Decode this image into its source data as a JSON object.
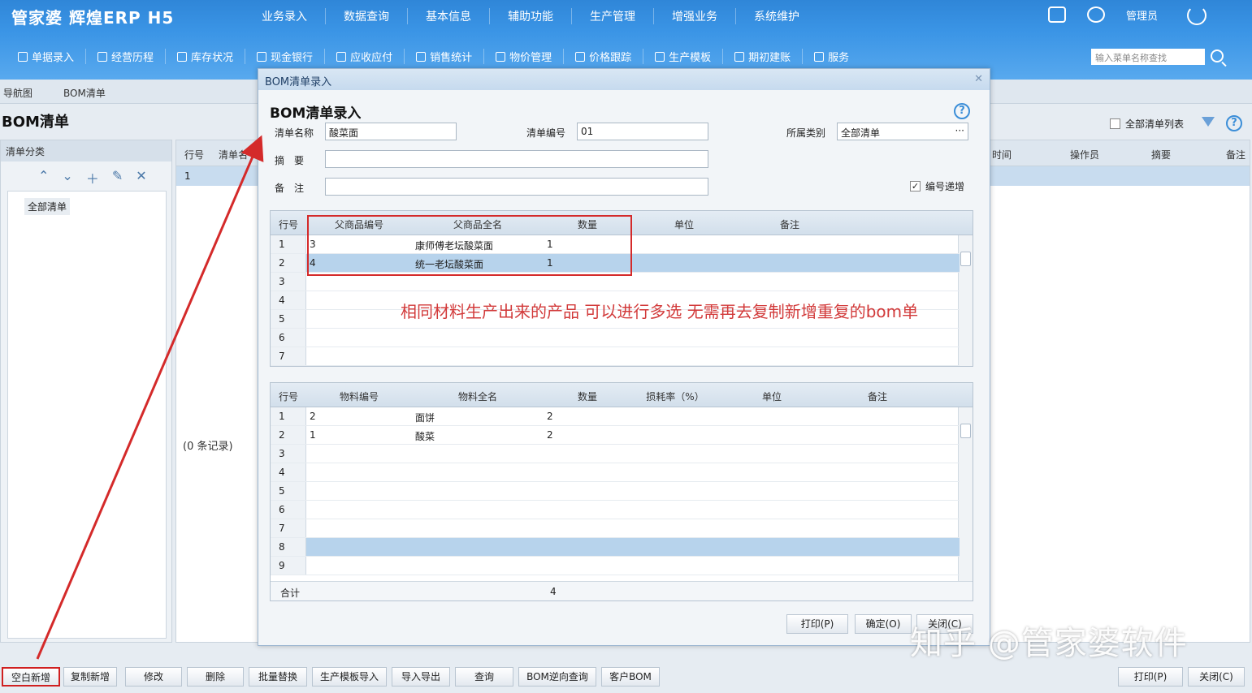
{
  "app": {
    "logo": "管家婆 辉煌ERP H5",
    "user": "管理员"
  },
  "menu": [
    "业务录入",
    "数据查询",
    "基本信息",
    "辅助功能",
    "生产管理",
    "增强业务",
    "系统维护"
  ],
  "toolbar": [
    "单据录入",
    "经营历程",
    "库存状况",
    "现金银行",
    "应收应付",
    "销售统计",
    "物价管理",
    "价格跟踪",
    "生产模板",
    "期初建账",
    "服务"
  ],
  "search": {
    "placeholder": "输入菜单名称查找"
  },
  "tabs": {
    "nav": "导航图",
    "bom": "BOM清单"
  },
  "page": {
    "title": "BOM清单",
    "show_all": "全部清单列表"
  },
  "left": {
    "header": "清单分类",
    "tree_item": "全部清单"
  },
  "bg_grid": {
    "headers": [
      "行号",
      "清单名",
      "时间",
      "操作员",
      "摘要",
      "备注"
    ],
    "row1": "1",
    "count": "(0 条记录)"
  },
  "dialog": {
    "title": "BOM清单录入",
    "heading": "BOM清单录入",
    "name_label": "清单名称",
    "name_value": "酸菜面",
    "code_label": "清单编号",
    "code_value": "01",
    "cat_label": "所属类别",
    "cat_value": "全部清单",
    "summary_label": "摘　要",
    "note_label": "备　注",
    "auto_inc": "编号递增",
    "parent_headers": [
      "行号",
      "父商品编号",
      "父商品全名",
      "数量",
      "单位",
      "备注"
    ],
    "parent_rows": [
      {
        "n": "1",
        "code": "3",
        "name": "康师傅老坛酸菜面",
        "qty": "1"
      },
      {
        "n": "2",
        "code": "4",
        "name": "统一老坛酸菜面",
        "qty": "1"
      },
      {
        "n": "3"
      },
      {
        "n": "4"
      },
      {
        "n": "5"
      },
      {
        "n": "6"
      },
      {
        "n": "7"
      }
    ],
    "annotation": "相同材料生产出来的产品 可以进行多选 无需再去复制新增重复的bom单",
    "material_headers": [
      "行号",
      "物料编号",
      "物料全名",
      "数量",
      "损耗率（%）",
      "单位",
      "备注"
    ],
    "material_rows": [
      {
        "n": "1",
        "code": "2",
        "name": "面饼",
        "qty": "2"
      },
      {
        "n": "2",
        "code": "1",
        "name": "酸菜",
        "qty": "2"
      },
      {
        "n": "3"
      },
      {
        "n": "4"
      },
      {
        "n": "5"
      },
      {
        "n": "6"
      },
      {
        "n": "7"
      },
      {
        "n": "8"
      },
      {
        "n": "9"
      }
    ],
    "total_label": "合计",
    "total_qty": "4",
    "print": "打印(P)",
    "ok": "确定(O)",
    "close": "关闭(C)"
  },
  "bottom": [
    "空白新增",
    "复制新增",
    "修改",
    "删除",
    "批量替换",
    "生产模板导入",
    "导入导出",
    "查询",
    "BOM逆向查询",
    "客户BOM"
  ],
  "bottom_right": {
    "print": "打印(P)",
    "close": "关闭(C)"
  },
  "watermark": "知乎 @管家婆软件",
  "colors": {
    "accent": "#3b95e6",
    "highlight": "#d42a2a",
    "selected_row": "#b7d3ec"
  }
}
